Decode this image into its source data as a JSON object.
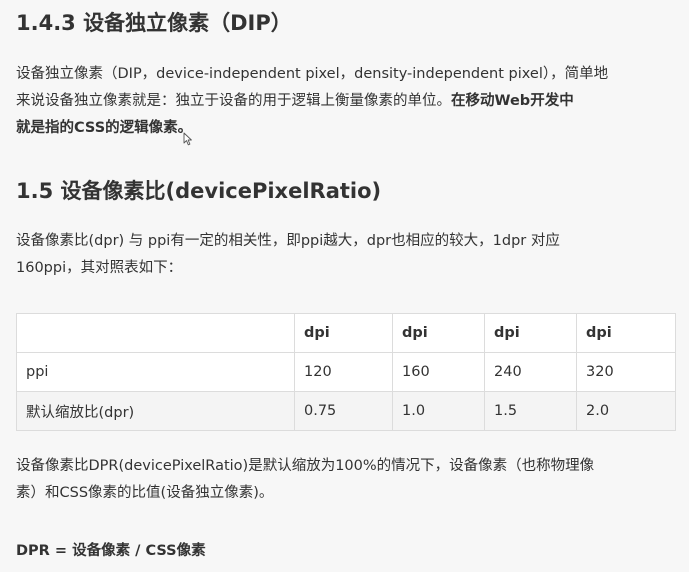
{
  "section_143": {
    "heading": "1.4.3 设备独立像素（DIP）",
    "line1": "设备独立像素（DIP，device-independent pixel，density-independent pixel），简单地",
    "line2_plain": "来说设备独立像素就是：独立于设备的用于逻辑上衡量像素的单位。",
    "line2_bold": "在移动Web开发中",
    "line3_bold": "就是指的CSS的逻辑像素。"
  },
  "section_15": {
    "heading": "1.5 设备像素比(devicePixelRatio)",
    "intro_line1": "设备像素比(dpr) 与 ppi有一定的相关性，即ppi越大，dpr也相应的较大，1dpr 对应",
    "intro_line2": "160ppi，其对照表如下："
  },
  "table": {
    "headers": [
      "",
      "dpi",
      "dpi",
      "dpi",
      "dpi"
    ],
    "rows": [
      [
        "ppi",
        "120",
        "160",
        "240",
        "320"
      ],
      [
        "默认缩放比(dpr)",
        "0.75",
        "1.0",
        "1.5",
        "2.0"
      ]
    ]
  },
  "summary": {
    "line1": "设备像素比DPR(devicePixelRatio)是默认缩放为100%的情况下，设备像素（也称物理像",
    "line2": "素）和CSS像素的比值(设备独立像素)。"
  },
  "formula": {
    "text": "DPR = 设备像素 / CSS像素"
  },
  "icons": {
    "cursor": "mouse-pointer-icon"
  }
}
